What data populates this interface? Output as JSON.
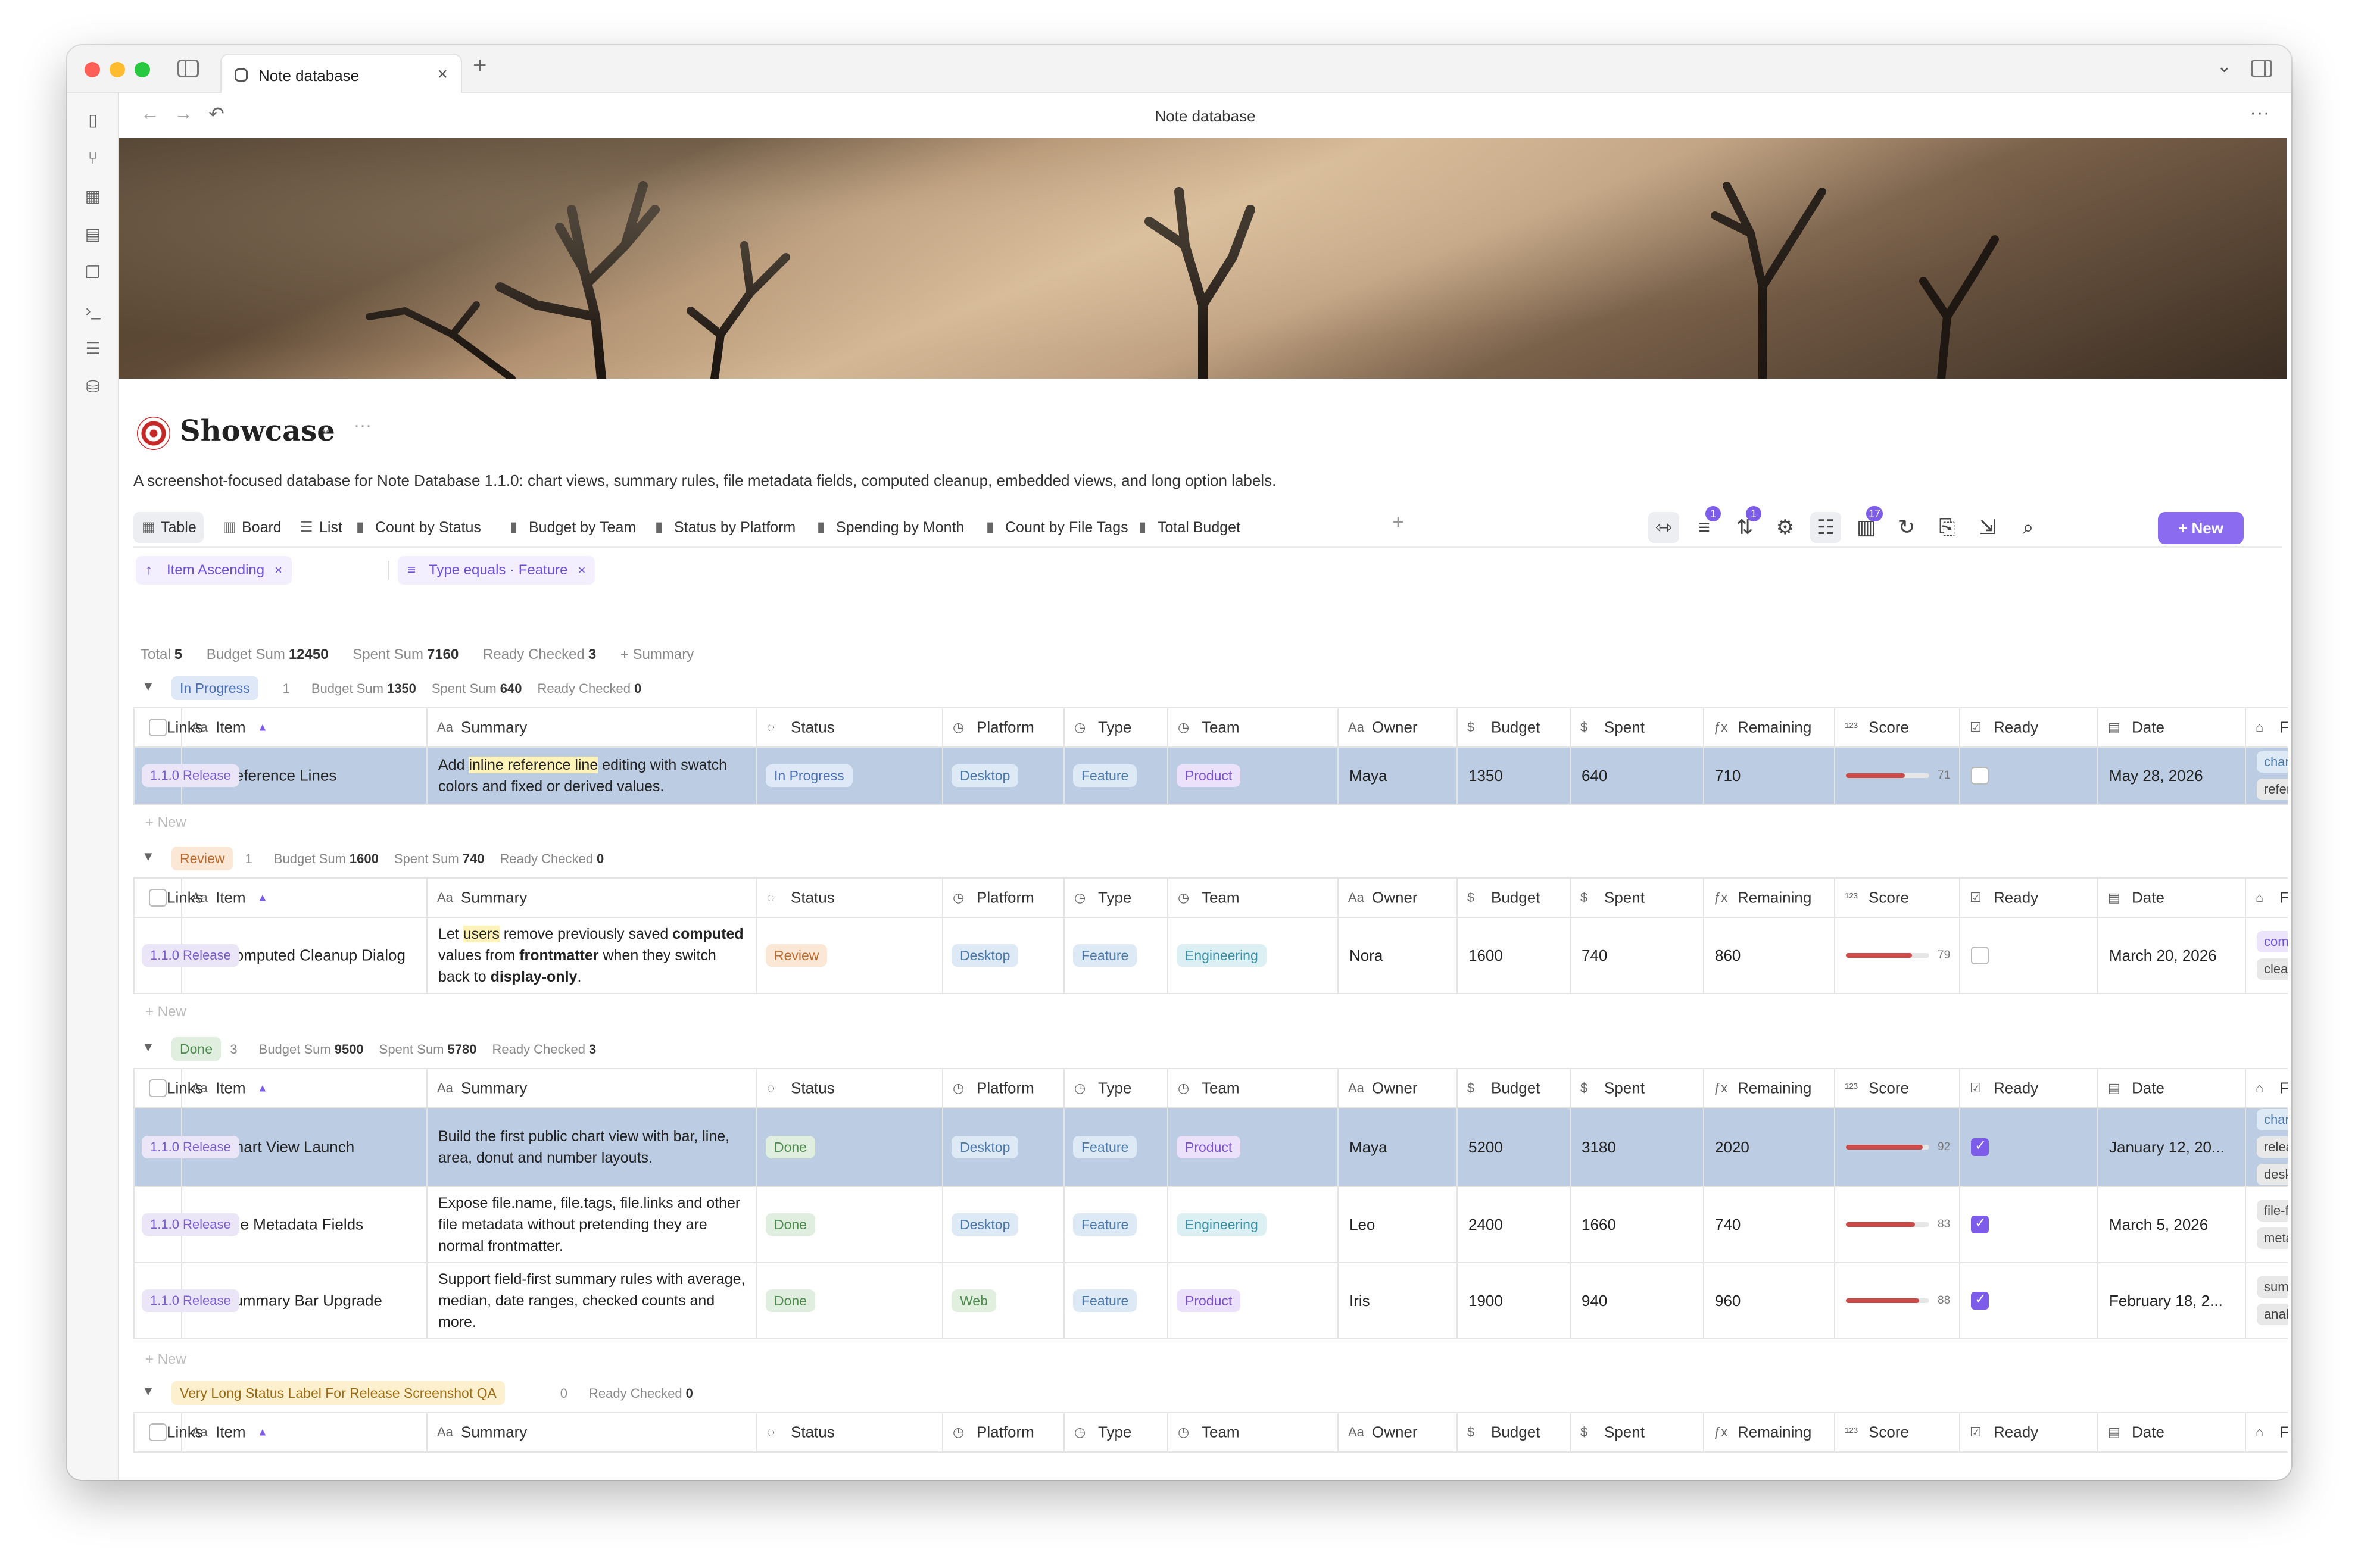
{
  "window": {
    "tab_title": "Note database",
    "tab_close": "×",
    "tab_add": "+",
    "nav_title": "Note database",
    "nav_more": "···",
    "nav_back": "←",
    "nav_forward": "→",
    "nav_history": "↶"
  },
  "page": {
    "title": "Showcase",
    "title_more": "···",
    "description": "A screenshot-focused database for Note Database 1.1.0: chart views, summary rules, file metadata fields, computed cleanup, embedded views, and long option labels."
  },
  "views": [
    {
      "label": "Table",
      "icon": "table-icon"
    },
    {
      "label": "Board",
      "icon": "board-icon"
    },
    {
      "label": "List",
      "icon": "list-icon"
    },
    {
      "label": "Count by Status",
      "icon": "chart-icon"
    },
    {
      "label": "Budget by Team",
      "icon": "chart-icon"
    },
    {
      "label": "Status by Platform",
      "icon": "chart-icon"
    },
    {
      "label": "Spending by Month",
      "icon": "chart-icon"
    },
    {
      "label": "Count by File Tags",
      "icon": "chart-icon"
    },
    {
      "label": "Total Budget",
      "icon": "chart-icon"
    }
  ],
  "toolbar": {
    "filter_badge": "1",
    "sort_badge": "1",
    "fields_badge": "17",
    "new_label": "+ New"
  },
  "chips": {
    "sort": "Item Ascending",
    "filter": "Type equals · Feature",
    "close": "×"
  },
  "summary": {
    "total_label": "Total",
    "total_value": "5",
    "budget_label": "Budget Sum",
    "budget_value": "12450",
    "spent_label": "Spent Sum",
    "spent_value": "7160",
    "ready_label": "Ready Checked",
    "ready_value": "3",
    "add_label": "+ Summary"
  },
  "columns": [
    {
      "label": "Item",
      "icon": "text-icon",
      "sort": "▲"
    },
    {
      "label": "Summary",
      "icon": "text-icon"
    },
    {
      "label": "Status",
      "icon": "status-icon"
    },
    {
      "label": "Platform",
      "icon": "select-icon"
    },
    {
      "label": "Type",
      "icon": "select-icon"
    },
    {
      "label": "Team",
      "icon": "select-icon"
    },
    {
      "label": "Owner",
      "icon": "text-icon"
    },
    {
      "label": "Budget",
      "icon": "currency-icon"
    },
    {
      "label": "Spent",
      "icon": "currency-icon"
    },
    {
      "label": "Remaining",
      "icon": "formula-icon"
    },
    {
      "label": "Score",
      "icon": "number-icon"
    },
    {
      "label": "Ready",
      "icon": "checkbox-icon"
    },
    {
      "label": "Date",
      "icon": "calendar-icon"
    },
    {
      "label": "File Tags",
      "icon": "tag-icon"
    },
    {
      "label": "Links",
      "icon": "tag-icon"
    }
  ],
  "add_new_label": "+ New",
  "groups": [
    {
      "name": "In Progress",
      "count": "1",
      "budget_label": "Budget Sum",
      "budget": "1350",
      "spent_label": "Spent Sum",
      "spent": "640",
      "ready_label": "Ready Checked",
      "ready": "0",
      "rows": [
        {
          "item": "Reference Lines",
          "summary_parts": [
            "Add ",
            "inline reference line",
            " editing with swatch colors and fixed or derived values."
          ],
          "status": "In Progress",
          "platform": "Desktop",
          "type": "Feature",
          "team": "Product",
          "owner": "Maya",
          "budget": "1350",
          "spent": "640",
          "remaining": "710",
          "score": 71,
          "score_text": "71",
          "ready": false,
          "date": "May 28, 2026",
          "file_tags": [
            "chart",
            "reference-line"
          ],
          "links": "1.1.0 Release"
        }
      ]
    },
    {
      "name": "Review",
      "count": "1",
      "budget_label": "Budget Sum",
      "budget": "1600",
      "spent_label": "Spent Sum",
      "spent": "740",
      "ready_label": "Ready Checked",
      "ready": "0",
      "rows": [
        {
          "item": "Computed Cleanup Dialog",
          "summary_parts": [
            "Let ",
            "users",
            " remove previously saved ",
            "computed",
            " values from ",
            "frontmatter",
            " when they switch back to ",
            "display-only",
            "."
          ],
          "status": "Review",
          "platform": "Desktop",
          "type": "Feature",
          "team": "Engineering",
          "owner": "Nora",
          "budget": "1600",
          "spent": "740",
          "remaining": "860",
          "score": 79,
          "score_text": "79",
          "ready": false,
          "date": "March 20, 2026",
          "file_tags": [
            "computed",
            "cleanup"
          ],
          "links": "1.1.0 Release"
        }
      ]
    },
    {
      "name": "Done",
      "count": "3",
      "budget_label": "Budget Sum",
      "budget": "9500",
      "spent_label": "Spent Sum",
      "spent": "5780",
      "ready_label": "Ready Checked",
      "ready": "3",
      "rows": [
        {
          "item": "Chart View Launch",
          "summary_parts": [
            "Build the first public chart view with bar, line, area, donut and number layouts."
          ],
          "status": "Done",
          "platform": "Desktop",
          "type": "Feature",
          "team": "Product",
          "owner": "Maya",
          "budget": "5200",
          "spent": "3180",
          "remaining": "2020",
          "score": 92,
          "score_text": "92",
          "ready": true,
          "date": "January 12, 20...",
          "file_tags": [
            "chart",
            "release",
            "desktop"
          ],
          "links": "1.1.0 Release"
        },
        {
          "item": "File Metadata Fields",
          "summary_parts": [
            "Expose file.name, file.tags, file.links and other file metadata without pretending they are normal frontmatter."
          ],
          "status": "Done",
          "platform": "Desktop",
          "type": "Feature",
          "team": "Engineering",
          "owner": "Leo",
          "budget": "2400",
          "spent": "1660",
          "remaining": "740",
          "score": 83,
          "score_text": "83",
          "ready": true,
          "date": "March 5, 2026",
          "file_tags": [
            "file-fields",
            "metadata"
          ],
          "links": "1.1.0 Release"
        },
        {
          "item": "Summary Bar Upgrade",
          "summary_parts": [
            "Support field-first summary rules with average, median, date ranges, checked counts and more."
          ],
          "status": "Done",
          "platform": "Web",
          "type": "Feature",
          "team": "Product",
          "owner": "Iris",
          "budget": "1900",
          "spent": "940",
          "remaining": "960",
          "score": 88,
          "score_text": "88",
          "ready": true,
          "date": "February 18, 2...",
          "file_tags": [
            "summary",
            "analytics"
          ],
          "links": "1.1.0 Release"
        }
      ]
    },
    {
      "name": "Very Long Status Label For Release Screenshot QA",
      "count": "0",
      "ready_label": "Ready Checked",
      "ready": "0",
      "rows": []
    }
  ],
  "colors": {
    "accent": "#8b6cf0",
    "selected_row": "#bccde3",
    "score_bar": "#cc4a47"
  }
}
